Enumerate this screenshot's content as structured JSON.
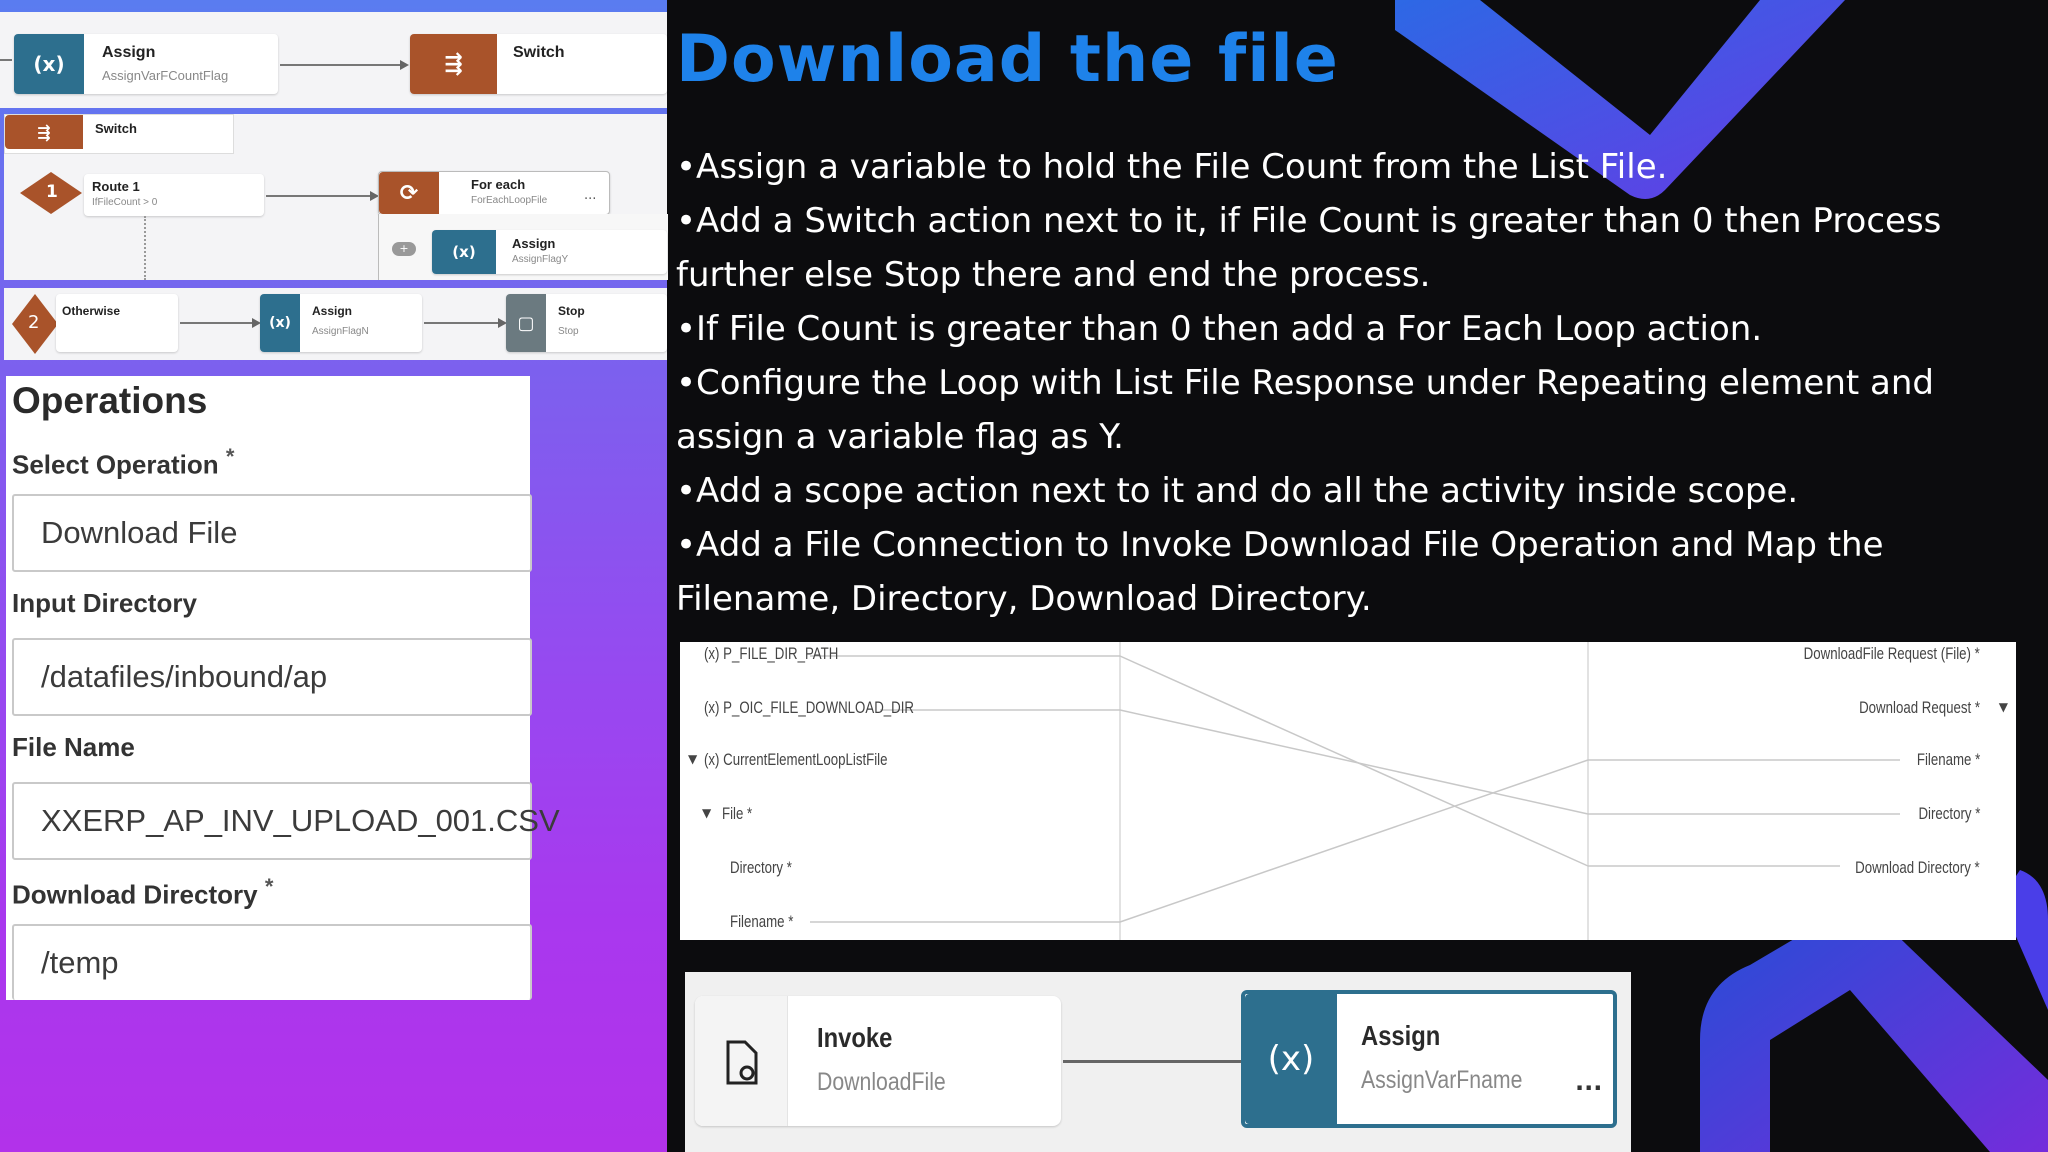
{
  "top_flow": {
    "assign": {
      "title": "Assign",
      "subtitle": "AssignVarFCountFlag",
      "icon": "(x)"
    },
    "switch": {
      "title": "Switch"
    }
  },
  "switch_flow": {
    "header": "Switch",
    "route1": {
      "number": "1",
      "title": "Route 1",
      "subtitle": "IfFileCount > 0"
    },
    "for_each": {
      "title": "For each",
      "subtitle": "ForEachLoopFile",
      "more": "..."
    },
    "assign_y": {
      "title": "Assign",
      "subtitle": "AssignFlagY",
      "icon": "(x)"
    }
  },
  "otherwise_flow": {
    "otherwise": {
      "number": "2",
      "title": "Otherwise"
    },
    "assign_n": {
      "title": "Assign",
      "subtitle": "AssignFlagN",
      "icon": "(x)"
    },
    "stop": {
      "title": "Stop",
      "subtitle": "Stop"
    }
  },
  "operations": {
    "title": "Operations",
    "select_operation_label": "Select Operation",
    "select_operation_value": "Download File",
    "input_directory_label": "Input Directory",
    "input_directory_value": "/datafiles/inbound/ap",
    "file_name_label": "File Name",
    "file_name_value": "XXERP_AP_INV_UPLOAD_001.CSV",
    "download_directory_label": "Download Directory",
    "download_directory_value": "/temp",
    "required_mark": "*"
  },
  "slide": {
    "heading": "Download the file",
    "bullets": [
      "•Assign a variable to hold the File Count from the List File.",
      "•Add a Switch action next to it, if File Count is greater than 0 then Process further else Stop there and end the process.",
      "•If File Count is greater than 0 then add a For Each Loop action.",
      "•Configure the Loop with List File Response under Repeating element and assign a variable flag as Y.",
      "•Add a scope action next to it and do all the activity inside scope.",
      "•Add a File Connection to Invoke Download File Operation and Map the Filename, Directory, Download Directory."
    ]
  },
  "mapper": {
    "sources": [
      "(x) P_FILE_DIR_PATH",
      "(x) P_OIC_FILE_DOWNLOAD_DIR",
      "(x) CurrentElementLoopListFile",
      "File *",
      "Directory *",
      "Filename *"
    ],
    "targets": [
      "DownloadFile Request (File) *",
      "Download Request *",
      "Filename *",
      "Directory *",
      "Download Directory *"
    ]
  },
  "bottom_flow": {
    "invoke": {
      "title": "Invoke",
      "subtitle": "DownloadFile"
    },
    "assign": {
      "title": "Assign",
      "subtitle": "AssignVarFname",
      "icon": "(x)",
      "more": "..."
    }
  },
  "colors": {
    "heading": "#1e82ea",
    "assign_tile": "#2d6f8e",
    "switch_tile": "#a9532a",
    "stop_tile": "#6b7a80"
  }
}
